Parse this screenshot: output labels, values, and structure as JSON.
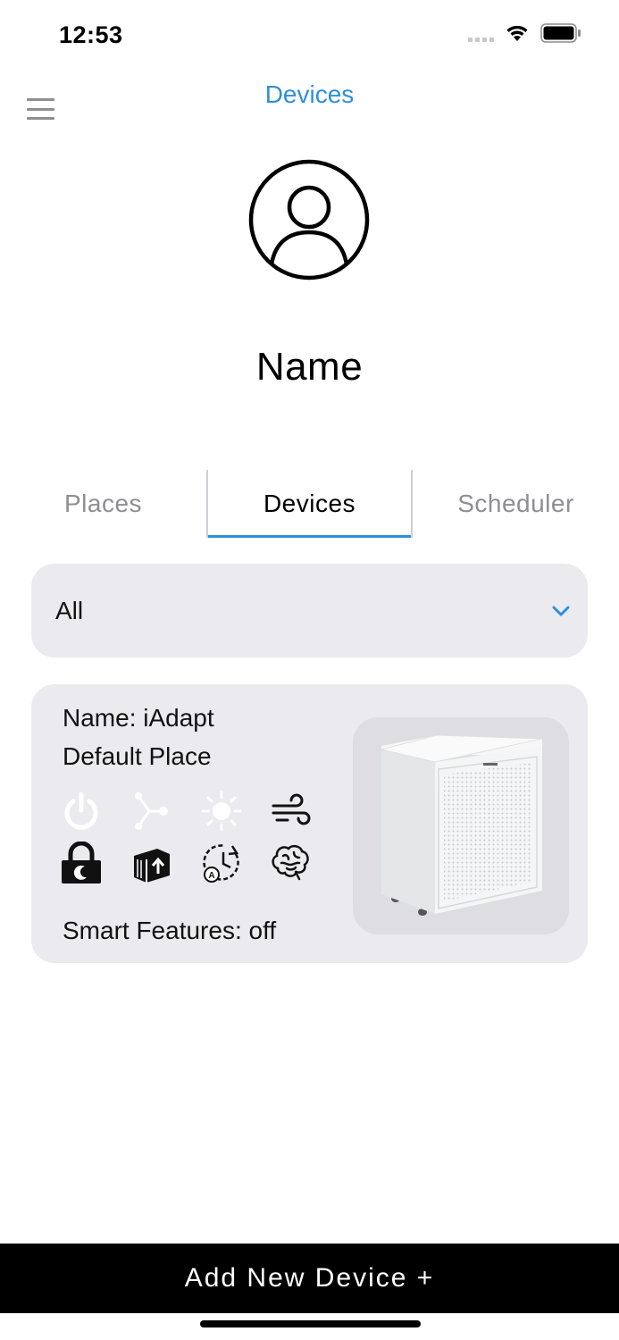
{
  "status_bar": {
    "time": "12:53"
  },
  "header": {
    "title": "Devices"
  },
  "profile": {
    "name": "Name"
  },
  "tabs": [
    {
      "label": "Places",
      "active": false
    },
    {
      "label": "Devices",
      "active": true
    },
    {
      "label": "Scheduler",
      "active": false
    }
  ],
  "filter": {
    "selected": "All"
  },
  "device": {
    "name": "Name: iAdapt",
    "place": "Default Place",
    "smart_features": "Smart Features: off",
    "icons": [
      "power-icon",
      "connection-icon",
      "light-icon",
      "fan-speed-icon",
      "sleep-lock-icon",
      "filter-icon",
      "auto-schedule-icon",
      "brain-icon"
    ]
  },
  "footer": {
    "add_device_label": "Add New Device +"
  },
  "colors": {
    "accent": "#2e8fdc",
    "card_bg": "#ebebef",
    "inactive_icon": "#ffffff",
    "active_icon": "#111111"
  }
}
